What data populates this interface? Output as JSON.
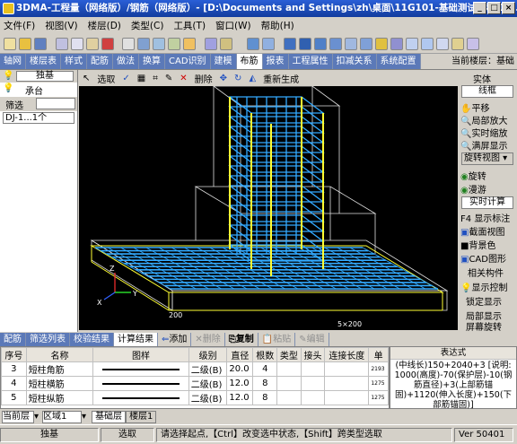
{
  "title": "3DMA-工程量（网络版）/钢筋（网络版）- [D:\\Documents and Settings\\zh\\桌面\\11G101-基础测试工程\\13...",
  "window_buttons": [
    "_",
    "□",
    "×"
  ],
  "menu": [
    "文件(F)",
    "视图(V)",
    "楼层(D)",
    "类型(C)",
    "工具(T)",
    "窗口(W)",
    "帮助(H)"
  ],
  "tabs": [
    "轴网",
    "楼层表",
    "样式",
    "配筋",
    "做法",
    "换算",
    "CAD识别",
    "建模",
    "布筋",
    "报表",
    "工程属性",
    "扣减关系",
    "系统配置"
  ],
  "active_tab": "布筋",
  "current_layer_label": "当前楼层：基础",
  "left": {
    "item1": "独基",
    "item2": "承台",
    "filter_label": "筛选",
    "tree_item": "DJ-1...1个"
  },
  "vtool": {
    "select": "选取",
    "delete": "删除",
    "regen": "重新生成"
  },
  "viewport": {
    "dim1": "200",
    "dim2": "5×200",
    "axis_x": "X",
    "axis_y": "Y",
    "axis_z": "Z"
  },
  "right": {
    "entity": "实体",
    "frame": "线框",
    "pan": "平移",
    "zoom_local": "局部放大",
    "zoom_rt": "实时缩放",
    "full": "满屏显示",
    "rotate_view": "旋转视图",
    "rotate": "旋转",
    "roam": "漫游",
    "calc": "实时计算",
    "f4": "F4",
    "show_label": "显示标注",
    "section": "截面视图",
    "bg": "背景色",
    "cad": "CAD图形",
    "related": "相关构件",
    "display_ctrl": "显示控制",
    "lock_display": "锁定显示",
    "local_display": "局部显示",
    "screen_rotate": "屏幕旋转"
  },
  "bottom_tabs": [
    "配筋",
    "筛选列表",
    "校验结果",
    "计算结果"
  ],
  "bottom_actions": {
    "add": "添加",
    "del": "删除",
    "copy": "复制",
    "paste": "粘贴",
    "edit": "编辑"
  },
  "table": {
    "headers": [
      "序号",
      "名称",
      "图样",
      "级别",
      "直径",
      "根数",
      "类型",
      "接头",
      "连接长度",
      "单"
    ],
    "rows": [
      [
        "3",
        "短柱角筋",
        "",
        "二级(B)",
        "20.0",
        "4",
        "",
        "",
        "",
        "2193"
      ],
      [
        "4",
        "短柱横筋",
        "",
        "二级(B)",
        "12.0",
        "8",
        "",
        "",
        "",
        "1275"
      ],
      [
        "5",
        "短柱纵筋",
        "",
        "二级(B)",
        "12.0",
        "8",
        "",
        "",
        "",
        "1275"
      ]
    ]
  },
  "expression": {
    "header": "表达式",
    "text": "(中线长)150+2040+3 [说明: 1000(高度)-70(保护层)-10(钢筋直径)+3(上部筋锚固)+1120(伸入长度)+150(下部筋锚固)]"
  },
  "layerbar": {
    "current": "当前层",
    "region": "区域1",
    "tab1": "基础层",
    "tab2": "楼层1"
  },
  "status": {
    "s1": "独基",
    "s2": "选取",
    "msg": "请选择起点,【Ctrl】改变选中状态,【Shift】跨类型选取",
    "ver": "Ver 50401"
  },
  "colors": {
    "rebar_blue": "#33aaff",
    "rebar_yellow": "#ffff33",
    "frame_white": "#ffffff"
  }
}
